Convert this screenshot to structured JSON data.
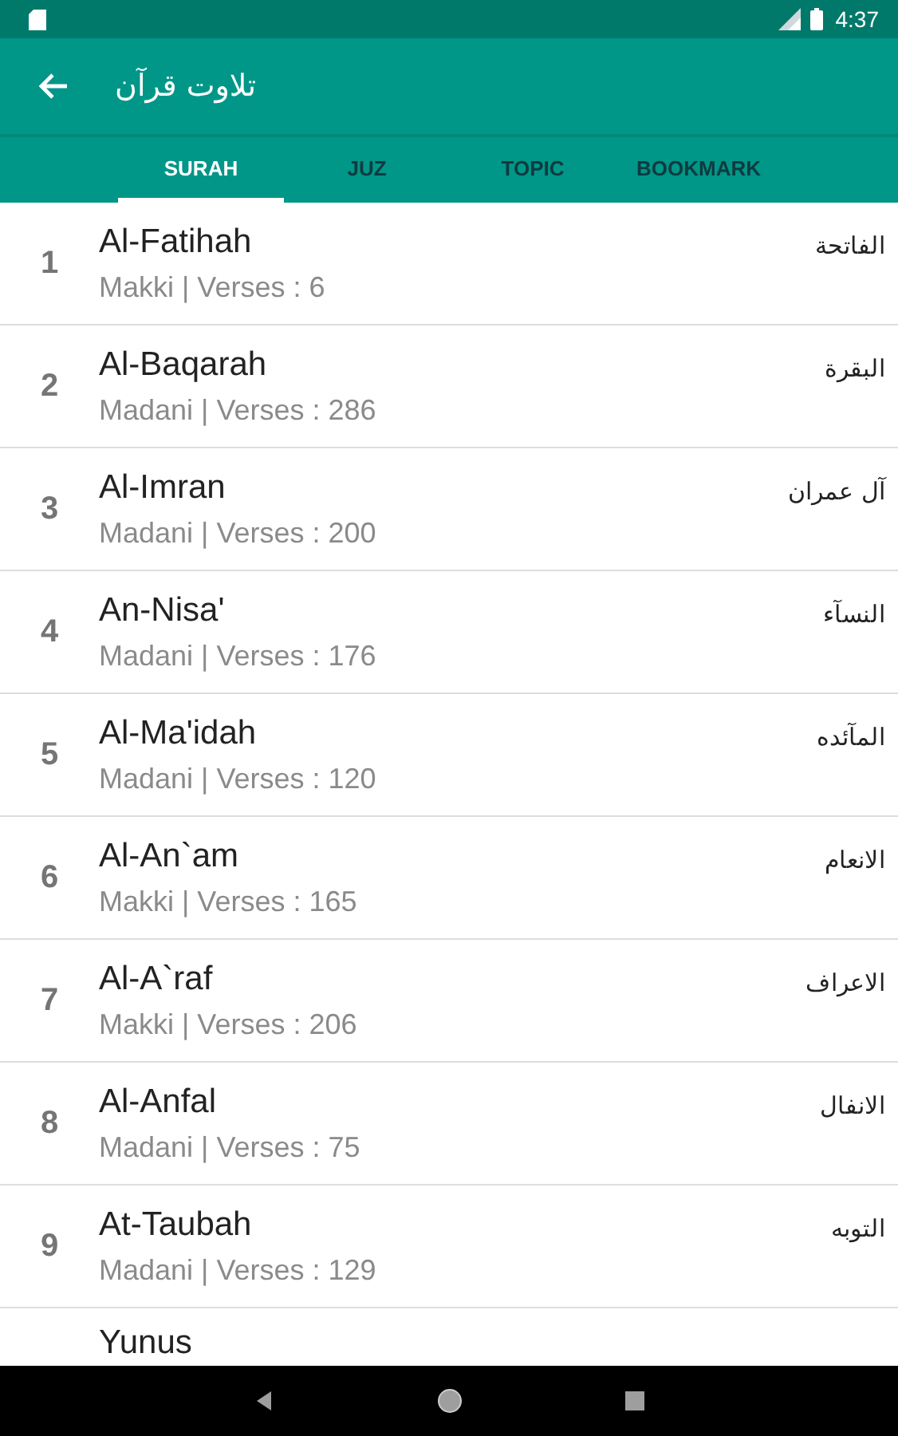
{
  "status_bar": {
    "time": "4:37"
  },
  "app_bar": {
    "title": "تلاوت قرآن"
  },
  "tabs": [
    {
      "label": "SURAH",
      "selected": true
    },
    {
      "label": "JUZ",
      "selected": false
    },
    {
      "label": "TOPIC",
      "selected": false
    },
    {
      "label": "BOOKMARK",
      "selected": false
    }
  ],
  "surahs": [
    {
      "number": "1",
      "name": "Al-Fatihah",
      "info": "Makki | Verses : 6",
      "arabic": "الفاتحة"
    },
    {
      "number": "2",
      "name": "Al-Baqarah",
      "info": "Madani | Verses : 286",
      "arabic": "البقرة"
    },
    {
      "number": "3",
      "name": "Al-Imran",
      "info": "Madani | Verses : 200",
      "arabic": "آل عمران"
    },
    {
      "number": "4",
      "name": "An-Nisa'",
      "info": "Madani | Verses : 176",
      "arabic": "النسآء"
    },
    {
      "number": "5",
      "name": "Al-Ma'idah",
      "info": "Madani | Verses : 120",
      "arabic": "المآئده"
    },
    {
      "number": "6",
      "name": "Al-An`am",
      "info": "Makki | Verses : 165",
      "arabic": "الانعام"
    },
    {
      "number": "7",
      "name": "Al-A`raf",
      "info": "Makki | Verses : 206",
      "arabic": "الاعراف"
    },
    {
      "number": "8",
      "name": "Al-Anfal",
      "info": "Madani | Verses : 75",
      "arabic": "الانفال"
    },
    {
      "number": "9",
      "name": "At-Taubah",
      "info": "Madani | Verses : 129",
      "arabic": "التوبه"
    },
    {
      "name": "Yunus"
    }
  ]
}
